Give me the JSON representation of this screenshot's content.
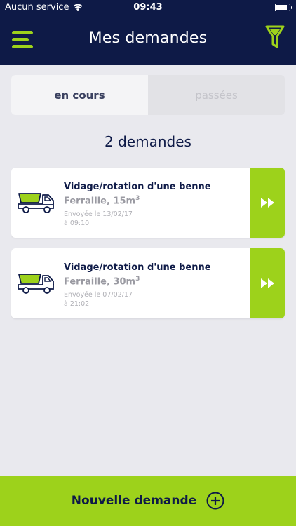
{
  "status_bar": {
    "carrier": "Aucun service",
    "time": "09:43",
    "battery_level": 0.85
  },
  "header": {
    "title": "Mes demandes",
    "menu_icon": "hamburger-menu-icon",
    "filter_icon": "filter-funnel-icon"
  },
  "tabs": [
    {
      "label": "en cours",
      "active": true
    },
    {
      "label": "passées",
      "active": false
    }
  ],
  "request_count": "2 demandes",
  "requests": [
    {
      "type": "Vidage/rotation d'une benne",
      "material": "Ferraille, 15m",
      "unit_sup": "3",
      "sent_date": "Envoyée le 13/02/17",
      "sent_time": "à 09:10"
    },
    {
      "type": "Vidage/rotation d'une benne",
      "material": "Ferraille, 30m",
      "unit_sup": "3",
      "sent_date": "Envoyée le 07/02/17",
      "sent_time": "à 21:02"
    }
  ],
  "new_request_button": {
    "label": "Nouvelle demande",
    "icon": "plus-circle-icon"
  },
  "colors": {
    "navy": "#0e1a47",
    "green": "#9dd21b",
    "background": "#e9e9ee"
  }
}
